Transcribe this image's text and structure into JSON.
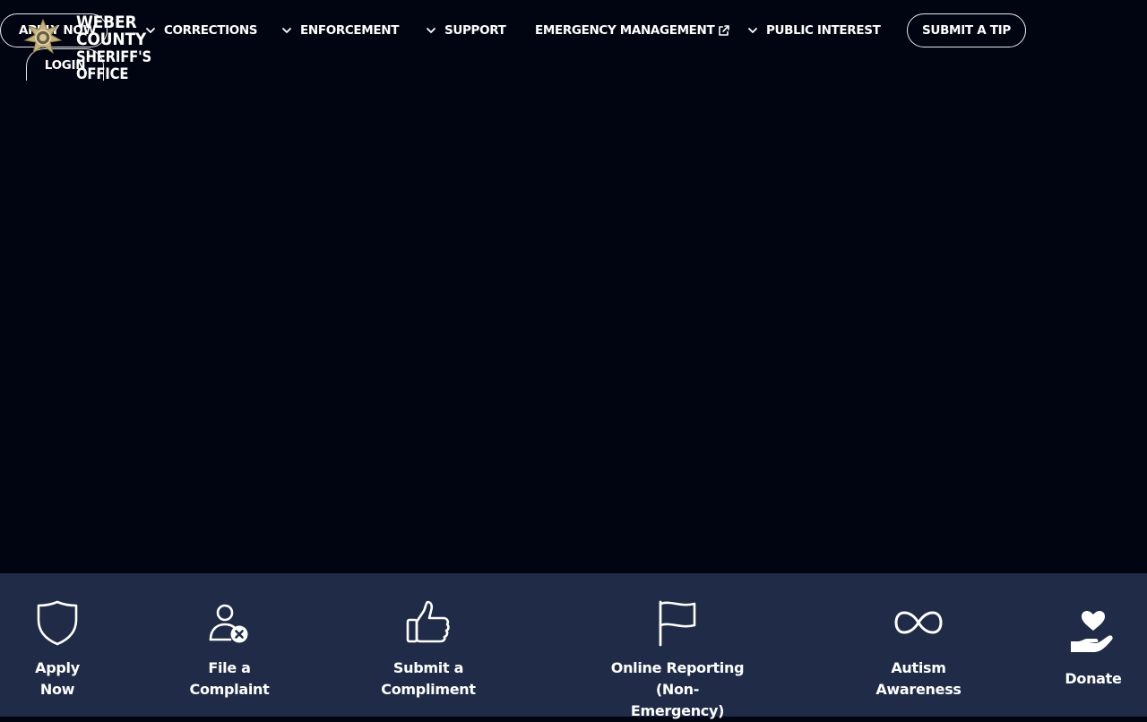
{
  "header": {
    "apply_label": "APPLY NOW",
    "login_label": "LOGIN",
    "brand": {
      "line1": "WEBER COUNTY",
      "line2": "SHERIFF'S OFFICE"
    },
    "menu": [
      {
        "label": "CORRECTIONS",
        "icon": "chevron-down-icon"
      },
      {
        "label": "ENFORCEMENT",
        "icon": "chevron-down-icon"
      },
      {
        "label": "SUPPORT",
        "icon": "chevron-down-icon"
      },
      {
        "label": "EMERGENCY MANAGEMENT",
        "icon": "external-link-icon"
      },
      {
        "label": "PUBLIC INTEREST",
        "icon": "chevron-down-icon"
      }
    ],
    "tip_label": "SUBMIT A TIP"
  },
  "quick_links": [
    {
      "label": "Apply\nNow",
      "icon": "shield-icon"
    },
    {
      "label": "File a\nComplaint",
      "icon": "user-remove-icon"
    },
    {
      "label": "Submit a\nCompliment",
      "icon": "thumbs-up-icon"
    },
    {
      "label": "Online Reporting (Non-\nEmergency)",
      "icon": "flag-icon"
    },
    {
      "label": "Autism\nAwareness",
      "icon": "infinity-icon"
    },
    {
      "label": "Donate",
      "icon": "heart-hand-icon"
    }
  ],
  "colors": {
    "background": "#000511",
    "quickbar": "#1f2b47",
    "text": "#ffffff"
  }
}
